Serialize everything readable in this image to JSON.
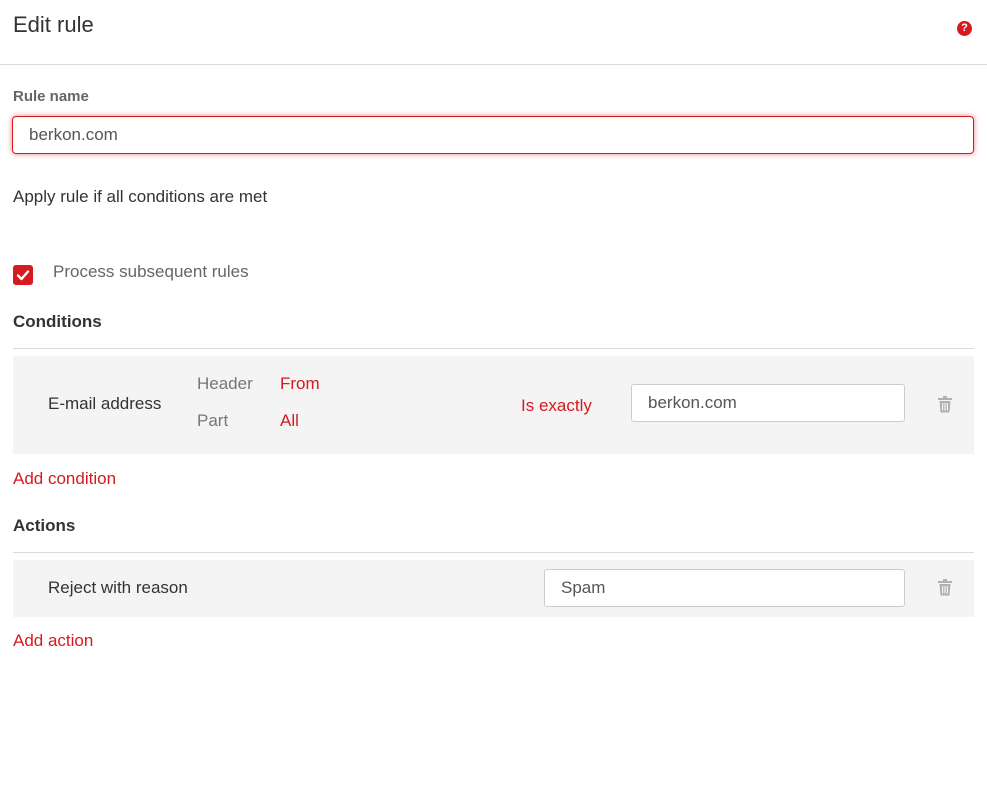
{
  "header": {
    "title": "Edit rule",
    "help_icon": "question-circle-icon"
  },
  "rule_name": {
    "label": "Rule name",
    "value": "berkon.com"
  },
  "apply_text": "Apply rule if all conditions are met",
  "process_subsequent": {
    "label": "Process subsequent rules",
    "checked": true
  },
  "conditions": {
    "heading": "Conditions",
    "items": [
      {
        "field": "E-mail address",
        "header_label": "Header",
        "header_value": "From",
        "part_label": "Part",
        "part_value": "All",
        "operator": "Is exactly",
        "value": "berkon.com"
      }
    ],
    "add_label": "Add condition"
  },
  "actions": {
    "heading": "Actions",
    "items": [
      {
        "action": "Reject with reason",
        "value": "Spam"
      }
    ],
    "add_label": "Add action"
  },
  "colors": {
    "accent": "#d71920",
    "row_background": "#f4f4f4",
    "divider": "#dcdcdc"
  }
}
